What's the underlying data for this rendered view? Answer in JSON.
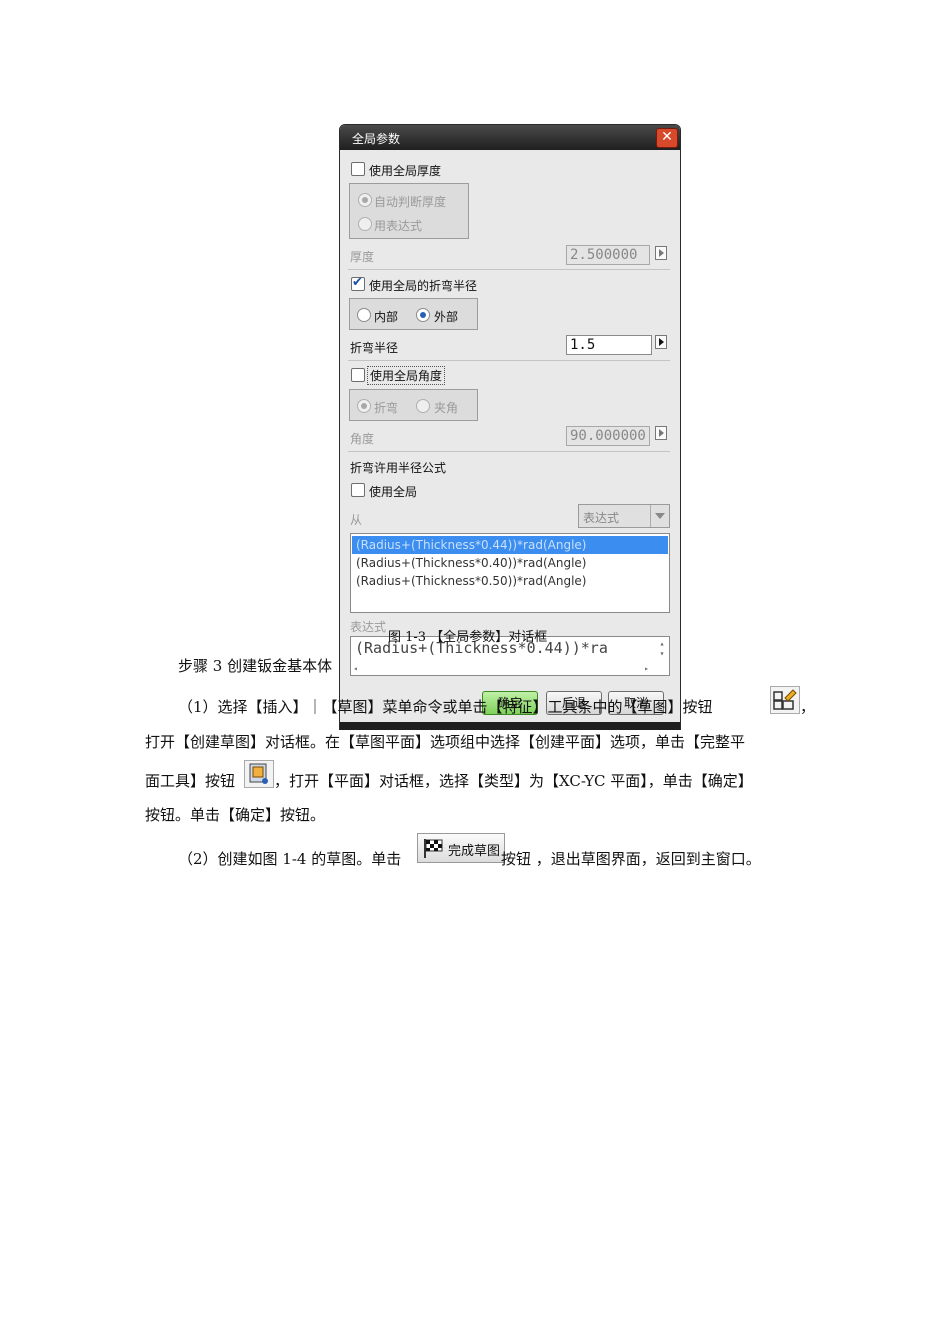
{
  "dialog": {
    "title": "全局参数",
    "use_global_thickness": "使用全局厚度",
    "thickness_auto": "自动判断厚度",
    "thickness_expr": "用表达式",
    "thickness_label": "厚度",
    "thickness_value": "2.500000",
    "use_global_bend_radius": "使用全局的折弯半径",
    "radius_inner": "内部",
    "radius_outer": "外部",
    "bend_radius_label": "折弯半径",
    "bend_radius_value": "1.5",
    "use_global_angle": "使用全局角度",
    "angle_bend": "折弯",
    "angle_included": "夹角",
    "angle_label": "角度",
    "angle_value": "90.000000",
    "bend_allowance_label": "折弯许用半径公式",
    "use_global": "使用全局",
    "from_label": "从",
    "from_value": "表达式",
    "formulas": [
      "(Radius+(Thickness*0.44))*rad(Angle)",
      "(Radius+(Thickness*0.40))*rad(Angle)",
      "(Radius+(Thickness*0.50))*rad(Angle)"
    ],
    "expression_label": "表达式",
    "expression_value": "(Radius+(Thickness*0.44))*ra",
    "ok_label": "确定",
    "back_label": "后退",
    "cancel_label": "取消"
  },
  "doc": {
    "caption": "图 1-3 【全局参数】对话框",
    "step3": "步骤 3 创建钣金基本体",
    "p1_line1_a": "（1）选择【插入】｜【草图】菜单命令或单击【特征】工具条中的【草图】按钮",
    "p1_line1_b": "，",
    "p1_line2": "打开【创建草图】对话框。在【草图平面】选项组中选择【创建平面】选项，单击【完整平",
    "p1_line3_a": "面工具】按钮",
    "p1_line3_b": "，打开【平面】对话框，选择【类型】为【XC-YC 平面】，单击【确定】",
    "p1_line4": "按钮。单击【确定】按钮。",
    "p2_a": "（2）创建如图 1-4 的草图。单击",
    "finish_sketch_label": "完成草图",
    "p2_b": "按钮 ，退出草图界面，返回到主窗口。"
  }
}
